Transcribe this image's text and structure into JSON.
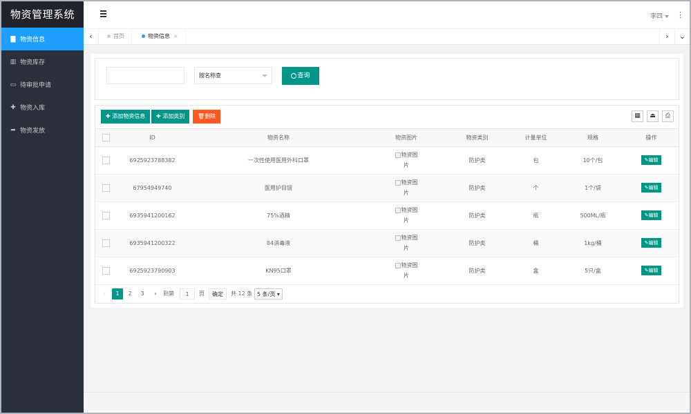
{
  "app": {
    "title": "物资管理系统"
  },
  "sidebar": {
    "items": [
      {
        "label": "物资信息",
        "icon": "book-icon",
        "glyph": "▇",
        "active": true
      },
      {
        "label": "物资库存",
        "icon": "bar-chart-icon",
        "glyph": "▥",
        "active": false
      },
      {
        "label": "待审批申请",
        "icon": "laptop-icon",
        "glyph": "▭",
        "active": false
      },
      {
        "label": "物资入库",
        "icon": "plus-icon",
        "glyph": "✚",
        "active": false
      },
      {
        "label": "物资发放",
        "icon": "share-icon",
        "glyph": "➦",
        "active": false
      }
    ]
  },
  "header": {
    "user": "李四",
    "more": "⋮"
  },
  "tabs": {
    "items": [
      {
        "label": "首页",
        "active": false
      },
      {
        "label": "物资信息",
        "active": true,
        "close": "×"
      }
    ]
  },
  "search": {
    "input_value": "",
    "select_value": "按名称查",
    "button_label": "查询"
  },
  "toolbar": {
    "add_item": "添加物资信息",
    "add_category": "添加类别",
    "delete": "删除"
  },
  "table": {
    "columns": [
      "ID",
      "物资名称",
      "物资图片",
      "物资类别",
      "计量单位",
      "规格",
      "操作"
    ],
    "image_alt": "物资图片",
    "edit_label": "编辑",
    "rows": [
      {
        "id": "6925923788382",
        "name": "一次性使用医用外科口罩",
        "category": "防护类",
        "unit": "包",
        "spec": "10个/包"
      },
      {
        "id": "67954949740",
        "name": "医用护目镜",
        "category": "防护类",
        "unit": "个",
        "spec": "1个/袋"
      },
      {
        "id": "6935941200162",
        "name": "75%酒精",
        "category": "防护类",
        "unit": "瓶",
        "spec": "500ML/瓶"
      },
      {
        "id": "6935941200322",
        "name": "84消毒液",
        "category": "防护类",
        "unit": "桶",
        "spec": "1kg/桶"
      },
      {
        "id": "6925923790903",
        "name": "KN95口罩",
        "category": "防护类",
        "unit": "盒",
        "spec": "5只/盒"
      }
    ]
  },
  "pager": {
    "pages": [
      "1",
      "2",
      "3"
    ],
    "current": "1",
    "goto_label": "到第",
    "goto_value": "1",
    "page_unit": "页",
    "confirm": "确定",
    "total": "共 12 条",
    "page_size": "5 条/页"
  }
}
